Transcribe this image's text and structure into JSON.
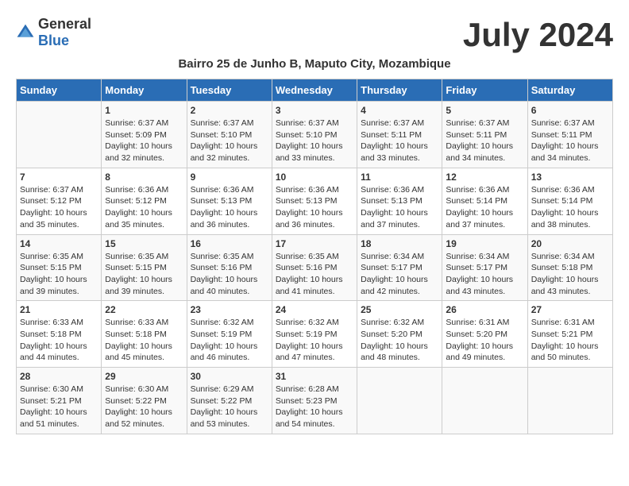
{
  "header": {
    "logo_general": "General",
    "logo_blue": "Blue",
    "month_title": "July 2024",
    "subtitle": "Bairro 25 de Junho B, Maputo City, Mozambique"
  },
  "days_of_week": [
    "Sunday",
    "Monday",
    "Tuesday",
    "Wednesday",
    "Thursday",
    "Friday",
    "Saturday"
  ],
  "weeks": [
    [
      {
        "day": "",
        "info": ""
      },
      {
        "day": "1",
        "info": "Sunrise: 6:37 AM\nSunset: 5:09 PM\nDaylight: 10 hours\nand 32 minutes."
      },
      {
        "day": "2",
        "info": "Sunrise: 6:37 AM\nSunset: 5:10 PM\nDaylight: 10 hours\nand 32 minutes."
      },
      {
        "day": "3",
        "info": "Sunrise: 6:37 AM\nSunset: 5:10 PM\nDaylight: 10 hours\nand 33 minutes."
      },
      {
        "day": "4",
        "info": "Sunrise: 6:37 AM\nSunset: 5:11 PM\nDaylight: 10 hours\nand 33 minutes."
      },
      {
        "day": "5",
        "info": "Sunrise: 6:37 AM\nSunset: 5:11 PM\nDaylight: 10 hours\nand 34 minutes."
      },
      {
        "day": "6",
        "info": "Sunrise: 6:37 AM\nSunset: 5:11 PM\nDaylight: 10 hours\nand 34 minutes."
      }
    ],
    [
      {
        "day": "7",
        "info": "Sunrise: 6:37 AM\nSunset: 5:12 PM\nDaylight: 10 hours\nand 35 minutes."
      },
      {
        "day": "8",
        "info": "Sunrise: 6:36 AM\nSunset: 5:12 PM\nDaylight: 10 hours\nand 35 minutes."
      },
      {
        "day": "9",
        "info": "Sunrise: 6:36 AM\nSunset: 5:13 PM\nDaylight: 10 hours\nand 36 minutes."
      },
      {
        "day": "10",
        "info": "Sunrise: 6:36 AM\nSunset: 5:13 PM\nDaylight: 10 hours\nand 36 minutes."
      },
      {
        "day": "11",
        "info": "Sunrise: 6:36 AM\nSunset: 5:13 PM\nDaylight: 10 hours\nand 37 minutes."
      },
      {
        "day": "12",
        "info": "Sunrise: 6:36 AM\nSunset: 5:14 PM\nDaylight: 10 hours\nand 37 minutes."
      },
      {
        "day": "13",
        "info": "Sunrise: 6:36 AM\nSunset: 5:14 PM\nDaylight: 10 hours\nand 38 minutes."
      }
    ],
    [
      {
        "day": "14",
        "info": "Sunrise: 6:35 AM\nSunset: 5:15 PM\nDaylight: 10 hours\nand 39 minutes."
      },
      {
        "day": "15",
        "info": "Sunrise: 6:35 AM\nSunset: 5:15 PM\nDaylight: 10 hours\nand 39 minutes."
      },
      {
        "day": "16",
        "info": "Sunrise: 6:35 AM\nSunset: 5:16 PM\nDaylight: 10 hours\nand 40 minutes."
      },
      {
        "day": "17",
        "info": "Sunrise: 6:35 AM\nSunset: 5:16 PM\nDaylight: 10 hours\nand 41 minutes."
      },
      {
        "day": "18",
        "info": "Sunrise: 6:34 AM\nSunset: 5:17 PM\nDaylight: 10 hours\nand 42 minutes."
      },
      {
        "day": "19",
        "info": "Sunrise: 6:34 AM\nSunset: 5:17 PM\nDaylight: 10 hours\nand 43 minutes."
      },
      {
        "day": "20",
        "info": "Sunrise: 6:34 AM\nSunset: 5:18 PM\nDaylight: 10 hours\nand 43 minutes."
      }
    ],
    [
      {
        "day": "21",
        "info": "Sunrise: 6:33 AM\nSunset: 5:18 PM\nDaylight: 10 hours\nand 44 minutes."
      },
      {
        "day": "22",
        "info": "Sunrise: 6:33 AM\nSunset: 5:18 PM\nDaylight: 10 hours\nand 45 minutes."
      },
      {
        "day": "23",
        "info": "Sunrise: 6:32 AM\nSunset: 5:19 PM\nDaylight: 10 hours\nand 46 minutes."
      },
      {
        "day": "24",
        "info": "Sunrise: 6:32 AM\nSunset: 5:19 PM\nDaylight: 10 hours\nand 47 minutes."
      },
      {
        "day": "25",
        "info": "Sunrise: 6:32 AM\nSunset: 5:20 PM\nDaylight: 10 hours\nand 48 minutes."
      },
      {
        "day": "26",
        "info": "Sunrise: 6:31 AM\nSunset: 5:20 PM\nDaylight: 10 hours\nand 49 minutes."
      },
      {
        "day": "27",
        "info": "Sunrise: 6:31 AM\nSunset: 5:21 PM\nDaylight: 10 hours\nand 50 minutes."
      }
    ],
    [
      {
        "day": "28",
        "info": "Sunrise: 6:30 AM\nSunset: 5:21 PM\nDaylight: 10 hours\nand 51 minutes."
      },
      {
        "day": "29",
        "info": "Sunrise: 6:30 AM\nSunset: 5:22 PM\nDaylight: 10 hours\nand 52 minutes."
      },
      {
        "day": "30",
        "info": "Sunrise: 6:29 AM\nSunset: 5:22 PM\nDaylight: 10 hours\nand 53 minutes."
      },
      {
        "day": "31",
        "info": "Sunrise: 6:28 AM\nSunset: 5:23 PM\nDaylight: 10 hours\nand 54 minutes."
      },
      {
        "day": "",
        "info": ""
      },
      {
        "day": "",
        "info": ""
      },
      {
        "day": "",
        "info": ""
      }
    ]
  ]
}
